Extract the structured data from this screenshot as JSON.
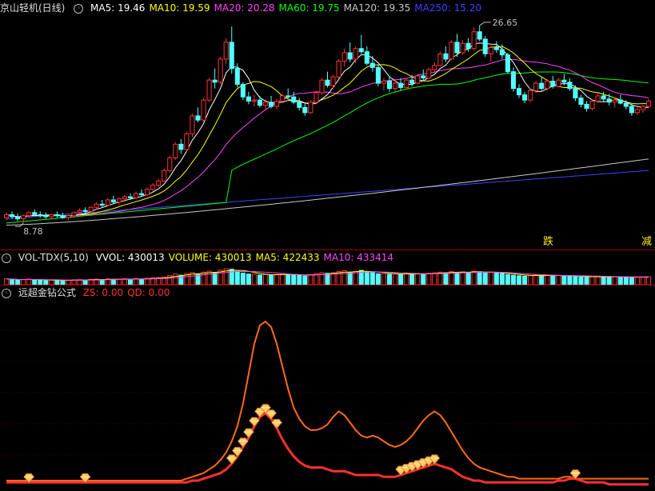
{
  "price_header": {
    "title": "京山轻机(日线)",
    "indicators": [
      {
        "label": "MA5: 19.46",
        "color": "#ffffff"
      },
      {
        "label": "MA10: 19.59",
        "color": "#ffff00"
      },
      {
        "label": "MA20: 20.28",
        "color": "#ff44ff"
      },
      {
        "label": "MA60: 19.75",
        "color": "#00ff00"
      },
      {
        "label": "MA120: 19.35",
        "color": "#c8c8c8"
      },
      {
        "label": "MA250: 15.20",
        "color": "#4040ff"
      }
    ]
  },
  "price_annotations": {
    "high": "26.65",
    "low": "8.78"
  },
  "signals": [
    {
      "text": "跌"
    },
    {
      "text": "减"
    }
  ],
  "vol_header": {
    "title": "VOL-TDX(5,10)",
    "indicators": [
      {
        "label": "VVOL: 430013",
        "color": "#ffffff"
      },
      {
        "label": "VOLUME: 430013",
        "color": "#ffff00"
      },
      {
        "label": "MA5: 422433",
        "color": "#ffff00"
      },
      {
        "label": "MA10: 433414",
        "color": "#ff44ff"
      }
    ]
  },
  "ind_header": {
    "title": "远超金钻公式",
    "indicators": [
      {
        "label": "ZS: 0.00",
        "color": "#ff3030"
      },
      {
        "label": "QD: 0.00",
        "color": "#ff3030"
      }
    ]
  },
  "colors": {
    "up": "#ff3232",
    "down": "#54ffff",
    "ma5": "#ffffff",
    "ma10": "#ffff00",
    "ma20": "#ff44ff",
    "ma60": "#00ff00",
    "ma120": "#c8c8c8",
    "ma250": "#4040ff",
    "zs": "#ff3030",
    "qd": "#ff6a1a",
    "diamond": "#ffcc66"
  },
  "icons": [
    "collapse-circle-icon",
    "diamond-icon"
  ],
  "chart_data": [
    {
      "type": "candlestick",
      "name": "price",
      "ylim": [
        7.5,
        28.5
      ],
      "annotations": [
        "26.65",
        "8.78"
      ],
      "candles": [
        [
          9.3,
          9.8,
          9.1,
          9.6
        ],
        [
          9.6,
          9.9,
          9.2,
          9.4
        ],
        [
          9.4,
          9.7,
          9.0,
          9.2
        ],
        [
          9.2,
          9.6,
          8.78,
          9.5
        ],
        [
          9.5,
          9.9,
          9.3,
          9.8
        ],
        [
          9.8,
          10.1,
          9.5,
          9.6
        ],
        [
          9.6,
          9.9,
          9.3,
          9.5
        ],
        [
          9.5,
          9.8,
          9.2,
          9.4
        ],
        [
          9.4,
          9.7,
          9.2,
          9.6
        ],
        [
          9.6,
          9.9,
          9.3,
          9.5
        ],
        [
          9.5,
          9.8,
          9.2,
          9.3
        ],
        [
          9.3,
          9.6,
          9.1,
          9.5
        ],
        [
          9.5,
          9.9,
          9.3,
          9.8
        ],
        [
          9.8,
          10.2,
          9.6,
          10.0
        ],
        [
          10.0,
          10.3,
          9.7,
          9.9
        ],
        [
          9.9,
          10.4,
          9.8,
          10.3
        ],
        [
          10.3,
          10.8,
          10.1,
          10.6
        ],
        [
          10.6,
          11.0,
          10.3,
          10.5
        ],
        [
          10.5,
          11.2,
          10.4,
          11.0
        ],
        [
          11.0,
          11.4,
          10.6,
          10.8
        ],
        [
          10.8,
          11.2,
          10.5,
          11.1
        ],
        [
          11.1,
          11.5,
          10.8,
          11.3
        ],
        [
          11.3,
          11.6,
          11.0,
          11.2
        ],
        [
          11.2,
          11.8,
          11.1,
          11.6
        ],
        [
          11.6,
          12.0,
          11.3,
          11.5
        ],
        [
          11.5,
          12.2,
          11.4,
          12.0
        ],
        [
          12.0,
          12.6,
          11.8,
          12.4
        ],
        [
          12.4,
          13.0,
          12.2,
          12.8
        ],
        [
          12.8,
          14.0,
          12.7,
          13.8
        ],
        [
          13.8,
          15.2,
          13.6,
          15.0
        ],
        [
          15.0,
          16.5,
          14.8,
          16.3
        ],
        [
          16.3,
          16.8,
          15.4,
          15.8
        ],
        [
          15.8,
          17.5,
          15.6,
          17.3
        ],
        [
          17.3,
          19.2,
          17.0,
          19.0
        ],
        [
          19.0,
          19.8,
          18.4,
          18.6
        ],
        [
          18.6,
          20.7,
          18.4,
          20.5
        ],
        [
          20.5,
          22.6,
          20.3,
          22.4
        ],
        [
          22.4,
          23.5,
          21.6,
          22.2
        ],
        [
          22.2,
          24.6,
          22.0,
          24.4
        ],
        [
          24.4,
          26.4,
          23.9,
          26.0
        ],
        [
          26.0,
          27.5,
          23.0,
          23.5
        ],
        [
          23.5,
          24.0,
          21.7,
          22.0
        ],
        [
          22.0,
          22.2,
          20.5,
          20.8
        ],
        [
          20.8,
          21.3,
          20.1,
          20.4
        ],
        [
          20.4,
          21.0,
          19.9,
          20.5
        ],
        [
          20.5,
          20.9,
          19.8,
          20.0
        ],
        [
          20.0,
          20.6,
          19.5,
          20.3
        ],
        [
          20.3,
          20.9,
          19.7,
          19.9
        ],
        [
          19.9,
          20.6,
          19.6,
          20.4
        ],
        [
          20.4,
          21.1,
          20.2,
          20.9
        ],
        [
          20.9,
          21.6,
          20.6,
          20.8
        ],
        [
          20.8,
          21.3,
          20.1,
          20.3
        ],
        [
          20.3,
          20.7,
          19.5,
          19.8
        ],
        [
          19.8,
          20.2,
          19.0,
          19.3
        ],
        [
          19.3,
          20.5,
          19.2,
          20.3
        ],
        [
          20.3,
          21.4,
          20.1,
          21.2
        ],
        [
          21.2,
          22.6,
          21.0,
          22.4
        ],
        [
          22.4,
          23.2,
          21.7,
          21.9
        ],
        [
          21.9,
          22.9,
          21.6,
          22.7
        ],
        [
          22.7,
          24.4,
          22.5,
          24.2
        ],
        [
          24.2,
          25.4,
          23.7,
          25.0
        ],
        [
          25.0,
          26.0,
          24.1,
          24.4
        ],
        [
          24.4,
          25.6,
          24.0,
          25.4
        ],
        [
          25.4,
          26.7,
          24.9,
          25.1
        ],
        [
          25.1,
          25.6,
          23.8,
          24.0
        ],
        [
          24.0,
          24.7,
          23.2,
          23.6
        ],
        [
          23.6,
          23.9,
          21.8,
          22.1
        ],
        [
          22.1,
          22.6,
          21.4,
          22.3
        ],
        [
          22.3,
          22.8,
          21.3,
          21.6
        ],
        [
          21.6,
          22.4,
          21.3,
          22.1
        ],
        [
          22.1,
          22.6,
          21.4,
          21.7
        ],
        [
          21.7,
          22.6,
          21.6,
          22.4
        ],
        [
          22.4,
          22.9,
          21.8,
          22.1
        ],
        [
          22.1,
          23.0,
          22.0,
          22.8
        ],
        [
          22.8,
          23.4,
          22.4,
          22.6
        ],
        [
          22.6,
          23.6,
          22.5,
          23.4
        ],
        [
          23.4,
          24.1,
          23.1,
          23.8
        ],
        [
          23.8,
          25.1,
          23.7,
          24.9
        ],
        [
          24.9,
          25.6,
          24.1,
          24.4
        ],
        [
          24.4,
          26.2,
          24.3,
          26.0
        ],
        [
          26.0,
          26.8,
          24.6,
          25.0
        ],
        [
          25.0,
          26.2,
          24.8,
          25.9
        ],
        [
          25.9,
          26.4,
          25.1,
          25.4
        ],
        [
          25.4,
          27.4,
          25.2,
          27.0
        ],
        [
          27.0,
          27.6,
          26.1,
          26.3
        ],
        [
          26.3,
          26.6,
          24.6,
          24.9
        ],
        [
          24.9,
          25.7,
          24.2,
          25.5
        ],
        [
          25.5,
          26.1,
          25.0,
          25.3
        ],
        [
          25.3,
          25.8,
          24.4,
          24.8
        ],
        [
          24.8,
          25.0,
          23.0,
          23.2
        ],
        [
          23.2,
          23.6,
          21.3,
          21.6
        ],
        [
          21.6,
          22.0,
          20.7,
          21.0
        ],
        [
          21.0,
          21.3,
          20.2,
          20.5
        ],
        [
          20.5,
          21.6,
          20.3,
          21.4
        ],
        [
          21.4,
          22.3,
          21.2,
          22.1
        ],
        [
          22.1,
          22.7,
          21.4,
          21.6
        ],
        [
          21.6,
          22.5,
          21.4,
          22.3
        ],
        [
          22.3,
          22.8,
          21.6,
          21.8
        ],
        [
          21.8,
          22.6,
          21.7,
          22.4
        ],
        [
          22.4,
          23.0,
          21.9,
          22.2
        ],
        [
          22.2,
          22.6,
          21.4,
          21.6
        ],
        [
          21.6,
          21.9,
          20.4,
          20.7
        ],
        [
          20.7,
          21.0,
          19.8,
          20.1
        ],
        [
          20.1,
          20.4,
          19.4,
          19.7
        ],
        [
          19.7,
          20.6,
          19.5,
          20.4
        ],
        [
          20.4,
          21.2,
          20.2,
          20.9
        ],
        [
          20.9,
          21.3,
          20.3,
          20.6
        ],
        [
          20.6,
          21.1,
          20.0,
          20.3
        ],
        [
          20.3,
          20.7,
          19.8,
          20.5
        ],
        [
          20.5,
          21.0,
          20.1,
          20.2
        ],
        [
          20.2,
          20.5,
          19.6,
          19.9
        ],
        [
          19.9,
          20.2,
          19.0,
          19.3
        ],
        [
          19.3,
          19.8,
          19.1,
          19.6
        ],
        [
          19.6,
          20.0,
          19.3,
          19.9
        ],
        [
          19.9,
          20.6,
          19.7,
          20.4
        ]
      ],
      "ma_periods": {
        "ma5": 5,
        "ma10": 10,
        "ma20": 20,
        "ma60": 60
      }
    },
    {
      "type": "bar",
      "name": "volume",
      "values": [
        60,
        55,
        48,
        52,
        58,
        50,
        46,
        44,
        47,
        45,
        43,
        46,
        50,
        52,
        49,
        55,
        58,
        52,
        60,
        55,
        57,
        61,
        56,
        64,
        58,
        66,
        70,
        72,
        80,
        95,
        110,
        98,
        115,
        125,
        112,
        130,
        140,
        128,
        150,
        165,
        160,
        138,
        120,
        110,
        108,
        100,
        104,
        98,
        106,
        112,
        108,
        100,
        95,
        90,
        105,
        115,
        125,
        118,
        122,
        135,
        145,
        130,
        138,
        148,
        132,
        125,
        112,
        115,
        108,
        112,
        106,
        114,
        110,
        116,
        112,
        118,
        122,
        130,
        124,
        135,
        128,
        132,
        126,
        140,
        134,
        122,
        126,
        120,
        116,
        105,
        98,
        92,
        88,
        95,
        100,
        94,
        98,
        92,
        96,
        94,
        90,
        84,
        80,
        78,
        82,
        86,
        84,
        80,
        82,
        80,
        78,
        74,
        76,
        78,
        82
      ],
      "ma5_values_unit": "x10000 shares (estimated)"
    },
    {
      "type": "line",
      "name": "indicator",
      "ylim": [
        0,
        100
      ],
      "series": [
        {
          "name": "ZS",
          "values": [
            3,
            3,
            3,
            3,
            3,
            3,
            3,
            3,
            3,
            3,
            3,
            3,
            3,
            3,
            3,
            3,
            3,
            3,
            3,
            3,
            3,
            3,
            3,
            3,
            3,
            3,
            3,
            3,
            3,
            3,
            3,
            3,
            4,
            5,
            6,
            7,
            9,
            11,
            14,
            18,
            24,
            32,
            44,
            60,
            76,
            86,
            88,
            85,
            76,
            64,
            52,
            42,
            36,
            32,
            30,
            30,
            31,
            33,
            37,
            40,
            38,
            34,
            30,
            27,
            26,
            27,
            26,
            24,
            22,
            21,
            22,
            24,
            27,
            31,
            35,
            38,
            40,
            38,
            34,
            29,
            24,
            19,
            15,
            12,
            10,
            9,
            8,
            7,
            6,
            5,
            5,
            4,
            4,
            4,
            4,
            4,
            4,
            4,
            4,
            5,
            5,
            4,
            4,
            4,
            4,
            4,
            4,
            4,
            4,
            4,
            4,
            4,
            4,
            4,
            4,
            4
          ]
        },
        {
          "name": "QD",
          "values": [
            2,
            2,
            2,
            2,
            2,
            2,
            2,
            2,
            2,
            2,
            2,
            2,
            2,
            2,
            2,
            2,
            2,
            2,
            2,
            2,
            2,
            2,
            2,
            2,
            2,
            2,
            2,
            2,
            2,
            2,
            2,
            2,
            2,
            3,
            3,
            4,
            5,
            6,
            7,
            9,
            12,
            16,
            21,
            26,
            32,
            37,
            39,
            36,
            31,
            25,
            20,
            16,
            13,
            11,
            10,
            10,
            10,
            9,
            8,
            8,
            8,
            7,
            6,
            6,
            6,
            6,
            6,
            5,
            5,
            5,
            6,
            7,
            8,
            9,
            10,
            11,
            12,
            11,
            10,
            9,
            7,
            5,
            4,
            3,
            3,
            2,
            2,
            2,
            2,
            2,
            2,
            2,
            2,
            2,
            2,
            2,
            2,
            2,
            3,
            3,
            4,
            4,
            3,
            2,
            2,
            2,
            2,
            1,
            1,
            1,
            1,
            1,
            1,
            1,
            1,
            1
          ]
        }
      ],
      "diamond_markers": [
        4,
        14,
        40,
        41,
        42,
        43,
        44,
        45,
        46,
        47,
        48,
        70,
        71,
        72,
        73,
        74,
        75,
        76,
        101
      ]
    }
  ]
}
